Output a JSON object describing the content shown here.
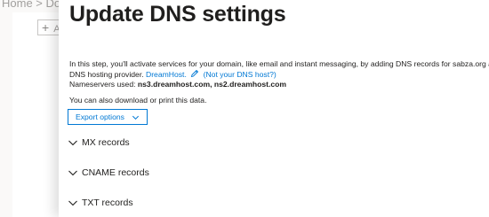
{
  "background": {
    "breadcrumb": "Home > Do"
  },
  "panel": {
    "title": "Update DNS settings",
    "intro": {
      "line1": "In this step, you'll activate services for your domain, like email and instant messaging, by adding DNS records for sabza.org at your",
      "line2_prefix": "DNS hosting provider.",
      "provider_link": "DreamHost.",
      "not_host_link": "(Not your DNS host?)",
      "nameservers_label": "Nameservers used:",
      "nameservers_value": "ns3.dreamhost.com, ns2.dreamhost.com"
    },
    "print_text": "You can also download or print this data.",
    "export_button_label": "Export options",
    "sections": [
      {
        "label": "MX records"
      },
      {
        "label": "CNAME records"
      },
      {
        "label": "TXT records"
      }
    ]
  },
  "colors": {
    "accent": "#0078d4",
    "text": "#201f1e",
    "muted": "#a19f9d"
  },
  "icons": {
    "edit": "pencil-icon",
    "export_chevron": "chevron-down-icon",
    "section_chevron": "chevron-down-icon"
  }
}
